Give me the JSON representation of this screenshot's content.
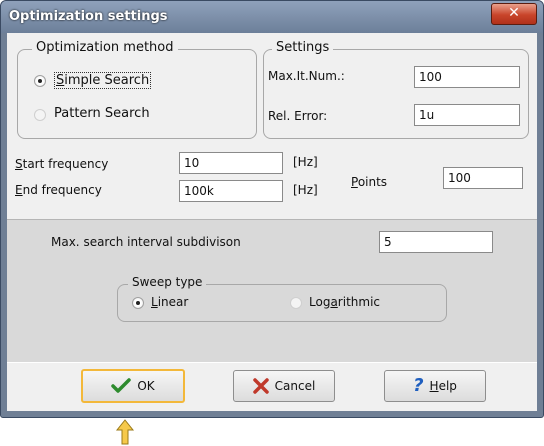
{
  "window": {
    "title": "Optimization settings",
    "close_glyph": "✕"
  },
  "method": {
    "legend": "Optimization method",
    "options": [
      {
        "label_hotkey": "S",
        "label_rest": "imple Search",
        "selected": true
      },
      {
        "label": "Pattern Search",
        "selected": false
      }
    ]
  },
  "settings": {
    "legend": "Settings",
    "max_it_label": "Max.It.Num.:",
    "max_it_value": "100",
    "rel_error_label": "Rel. Error:",
    "rel_error_value": "1u"
  },
  "frequency": {
    "start_hotkey": "S",
    "start_rest": "tart frequency",
    "start_value": "10",
    "start_unit": "[Hz]",
    "end_hotkey": "E",
    "end_rest": "nd frequency",
    "end_value": "100k",
    "end_unit": "[Hz]",
    "points_hotkey": "P",
    "points_rest": "oints",
    "points_value": "100"
  },
  "subdivision": {
    "label": "Max. search interval subdivison",
    "value": "5"
  },
  "sweep": {
    "legend": "Sweep type",
    "linear_hotkey": "L",
    "linear_rest": "inear",
    "linear_selected": true,
    "log_pre": "Log",
    "log_hotkey": "a",
    "log_rest": "rithmic",
    "log_selected": false
  },
  "buttons": {
    "ok_label": "OK",
    "cancel_label": "Cancel",
    "help_hotkey": "H",
    "help_rest": "elp"
  },
  "icons": {
    "ok": "check-icon",
    "cancel": "x-icon",
    "help": "question-icon",
    "pointer": "arrow-up-icon"
  },
  "colors": {
    "ok_check": "#2e8b2e",
    "cancel_x": "#c0392b",
    "help_q": "#1f5fbf",
    "focus": "#f3b83a",
    "arrow": "#f3b83a"
  }
}
